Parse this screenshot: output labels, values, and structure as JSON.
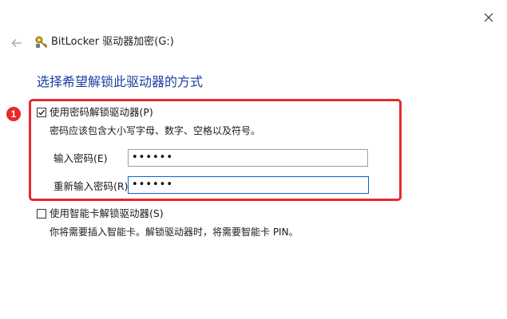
{
  "window": {
    "title": "BitLocker 驱动器加密(G:)"
  },
  "icons": {
    "close": "close-icon",
    "back": "back-arrow-icon",
    "app": "bitlocker-key-icon",
    "checkmark": "checkmark-icon"
  },
  "main": {
    "heading": "选择希望解锁此驱动器的方式",
    "step_badge": "1",
    "password_option": {
      "label": "使用密码解锁驱动器(P)",
      "checked": true,
      "description": "密码应该包含大小写字母、数字、空格以及符号。",
      "enter_password_label": "输入密码(E)",
      "enter_password_value": "••••••",
      "reenter_password_label": "重新输入密码(R)",
      "reenter_password_value": "••••••"
    },
    "smartcard_option": {
      "label": "使用智能卡解锁驱动器(S)",
      "checked": false,
      "description": "你将需要插入智能卡。解锁驱动器时，将需要智能卡 PIN。"
    }
  },
  "colors": {
    "heading": "#1a3fa0",
    "highlight": "#e8282d",
    "focus_border": "#0b63c9"
  }
}
